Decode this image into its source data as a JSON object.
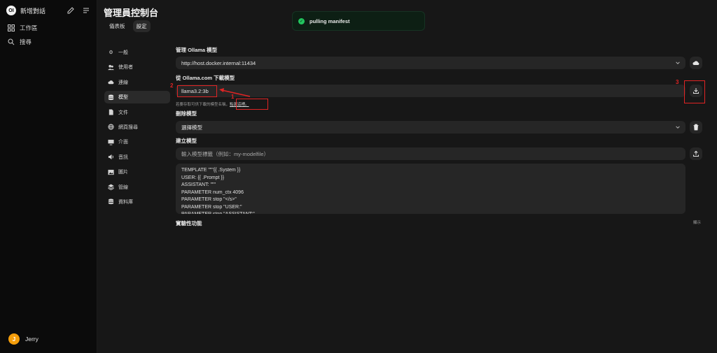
{
  "sidebar": {
    "logo_text": "OI",
    "new_chat": "新增對話",
    "items": [
      {
        "label": "工作區",
        "icon": "grid-icon"
      },
      {
        "label": "搜尋",
        "icon": "search-icon"
      }
    ],
    "user": {
      "initial": "J",
      "name": "Jerry"
    }
  },
  "header": {
    "title": "管理員控制台",
    "tabs": [
      {
        "label": "儀表板"
      },
      {
        "label": "設定"
      }
    ]
  },
  "toast": {
    "message": "pulling manifest"
  },
  "settings_nav": [
    {
      "label": "一般",
      "icon": "gear-icon"
    },
    {
      "label": "使用者",
      "icon": "users-icon"
    },
    {
      "label": "連線",
      "icon": "cloud-icon"
    },
    {
      "label": "模型",
      "icon": "database-icon"
    },
    {
      "label": "文件",
      "icon": "document-icon"
    },
    {
      "label": "網頁搜尋",
      "icon": "globe-icon"
    },
    {
      "label": "介面",
      "icon": "monitor-icon"
    },
    {
      "label": "音訊",
      "icon": "speaker-icon"
    },
    {
      "label": "圖片",
      "icon": "image-icon"
    },
    {
      "label": "管線",
      "icon": "pipeline-icon"
    },
    {
      "label": "資料庫",
      "icon": "database-icon"
    }
  ],
  "models": {
    "manage_label": "管理 Ollama 模型",
    "ollama_url": "http://host.docker.internal:11434",
    "download_label": "從 Ollama.com 下載模型",
    "model_tag_value": "llama3.2:3b",
    "hint_text": "若要存取可供下載的模型名稱，",
    "hint_link": "點選這裡。",
    "delete_label": "刪除模型",
    "delete_placeholder": "選擇模型",
    "create_label": "建立模型",
    "create_placeholder": "輸入模型標籤（例如：my-modelfile）",
    "modelfile_text": "TEMPLATE \"\"\"{{ .System }}\nUSER: {{ .Prompt }}\nASSISTANT: \"\"\"\nPARAMETER num_ctx 4096\nPARAMETER stop \"</s>\"\nPARAMETER stop \"USER:\"\nPARAMETER stop \"ASSISTANT:\"",
    "experimental_label": "實驗性功能",
    "show_label": "顯示"
  },
  "annotations": {
    "one": "1",
    "two": "2",
    "three": "3"
  },
  "colors": {
    "annotation": "#e02424",
    "success": "#22c55e",
    "avatar": "#f59e0b"
  }
}
